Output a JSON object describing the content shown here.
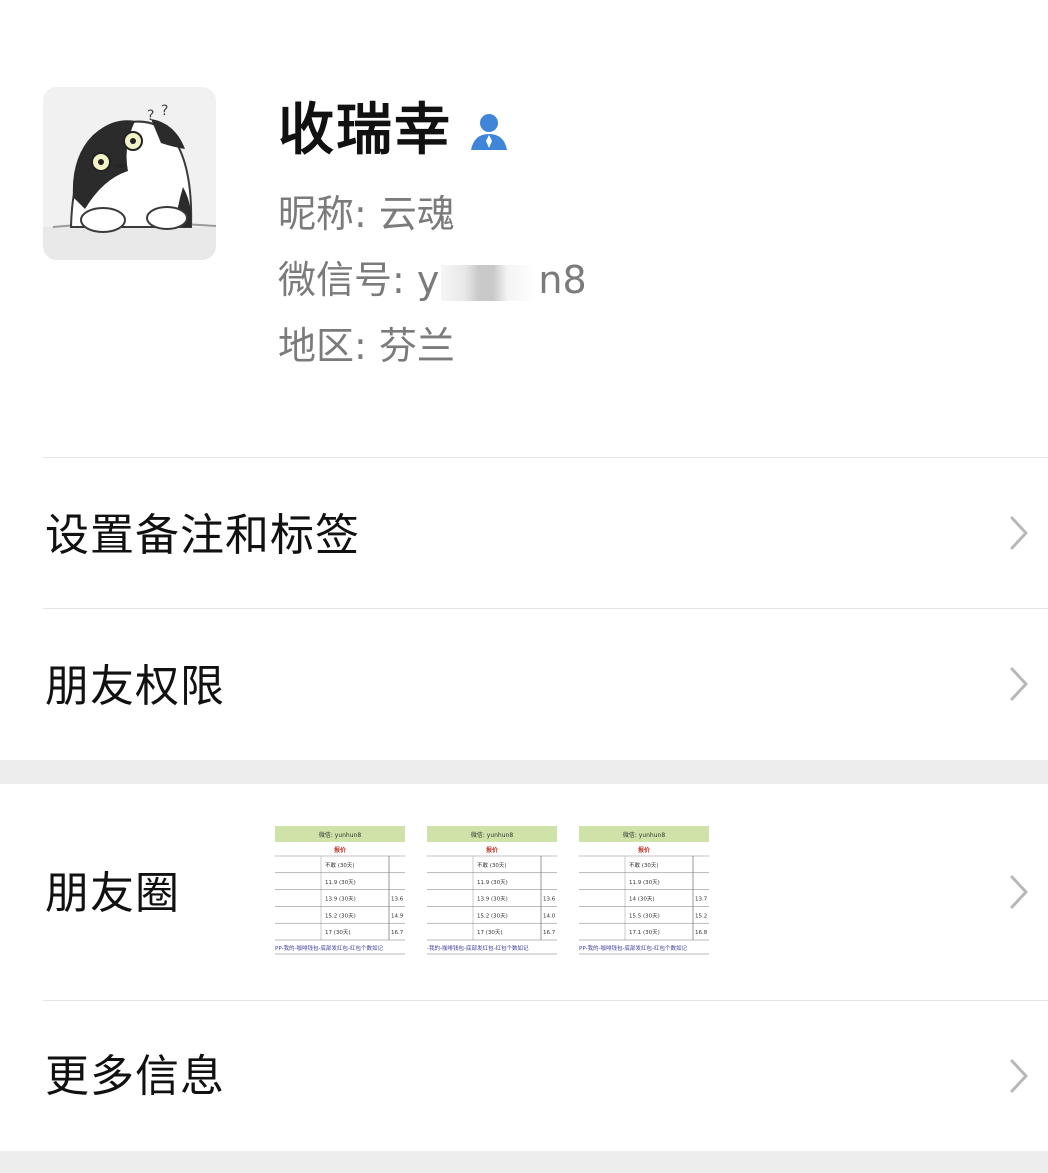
{
  "profile": {
    "display_name": "收瑞幸",
    "nickname_label": "昵称:",
    "nickname_value": "云魂",
    "wechat_id_label": "微信号:",
    "wechat_id_prefix": "y",
    "wechat_id_suffix": "n8",
    "region_label": "地区:",
    "region_value": "芬兰",
    "verify_icon": "person-icon",
    "verify_icon_color": "#3f86d8"
  },
  "menu": {
    "remark_tags": "设置备注和标签",
    "friend_permissions": "朋友权限",
    "moments": "朋友圈",
    "more_info": "更多信息"
  },
  "moments_thumbs": [
    {
      "header": "微信: yunhun8",
      "subheader": "报价",
      "rows": [
        "不敢 (30天)",
        "11.9 (30天)",
        "13.9 (30天)",
        "15.2 (30天)",
        "17 (30天)"
      ],
      "side": [
        "",
        "",
        "13.6",
        "14.9",
        "16.7"
      ],
      "footer": "PP-我的-咖啡钱包-底部发红包-红包个数如记"
    },
    {
      "header": "微信: yunhun8",
      "subheader": "报价",
      "rows": [
        "不敢 (30天)",
        "11.9 (30天)",
        "13.9 (30天)",
        "15.2 (30天)",
        "17 (30天)"
      ],
      "side": [
        "",
        "",
        "13.6",
        "14.0",
        "16.7"
      ],
      "footer": "-我的-咖啡钱包-底部发红包-红包个数如记"
    },
    {
      "header": "微信: yunhun8",
      "subheader": "报价",
      "rows": [
        "不敢 (30天)",
        "11.9 (30天)",
        "14 (30天)",
        "15.5 (30天)",
        "17.1 (30天)"
      ],
      "side": [
        "",
        "",
        "13.7",
        "15.2",
        "16.8"
      ],
      "footer": "PP-我的-咖啡钱包-底部发红包-红包个数如记"
    }
  ],
  "colors": {
    "background": "#ffffff",
    "section_gap": "#ededed",
    "secondary_text": "#7b7b7b",
    "thumb_header": "#cfe3a8",
    "thumb_red": "#c0392b",
    "thumb_footer": "#3b3b9a"
  }
}
